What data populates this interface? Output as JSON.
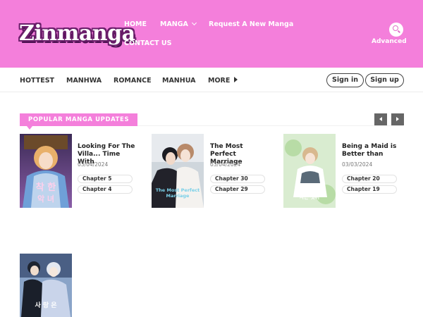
{
  "header": {
    "logo": "Zinmanga",
    "nav": {
      "home": "HOME",
      "manga": "MANGA",
      "request": "Request A New Manga",
      "contact": "CONTACT US"
    },
    "advanced": "Advanced",
    "colors": {
      "header_bg": "#f47fdb",
      "logo_outline": "#6a1e6a"
    },
    "icons": {
      "search": "search-icon",
      "manga_dropdown": "chevron-down-icon"
    }
  },
  "subnav": {
    "items": [
      "HOTTEST",
      "MANHWA",
      "ROMANCE",
      "MANHUA",
      "MORE"
    ],
    "more_icon": "caret-right-icon",
    "sign_in": "Sign in",
    "sign_up": "Sign up"
  },
  "section": {
    "title": "POPULAR MANGA UPDATES",
    "prev_icon": "arrow-left-icon",
    "next_icon": "arrow-right-icon"
  },
  "manga": [
    {
      "title": "Looking For The Villa... Time With",
      "date": "03/04/2024",
      "chapters": [
        "Chapter 5",
        "Chapter 4"
      ]
    },
    {
      "title": "The Most Perfect Marriage",
      "date": "03/04/2024",
      "chapters": [
        "Chapter 30",
        "Chapter 29"
      ]
    },
    {
      "title": "Being a Maid is Better than",
      "date": "03/03/2024",
      "chapters": [
        "Chapter 20",
        "Chapter 19"
      ]
    },
    {
      "title": "",
      "date": "",
      "chapters": []
    }
  ]
}
